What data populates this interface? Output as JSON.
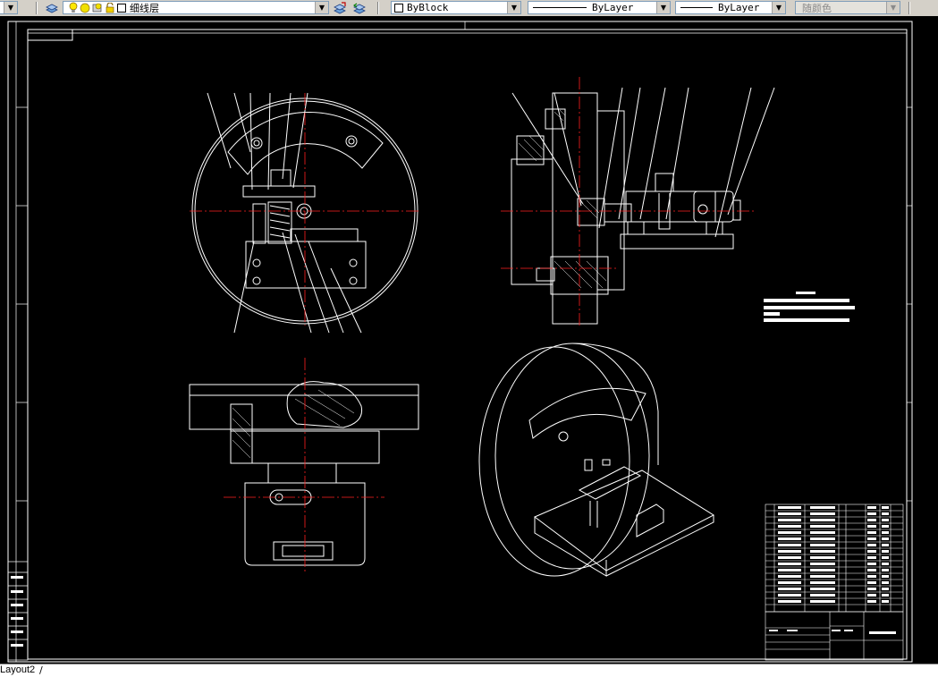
{
  "toolbar": {
    "layer_name": "细线层",
    "color_value": "ByBlock",
    "linetype_value": "ByLayer",
    "lineweight_value": "ByLayer",
    "plotstyle_value": "随颜色"
  },
  "layout_tab": "Layout2",
  "colors": {
    "background": "#000000",
    "linework": "#ffffff",
    "centerline": "#ff0000",
    "toolbar": "#d4d0c8"
  }
}
